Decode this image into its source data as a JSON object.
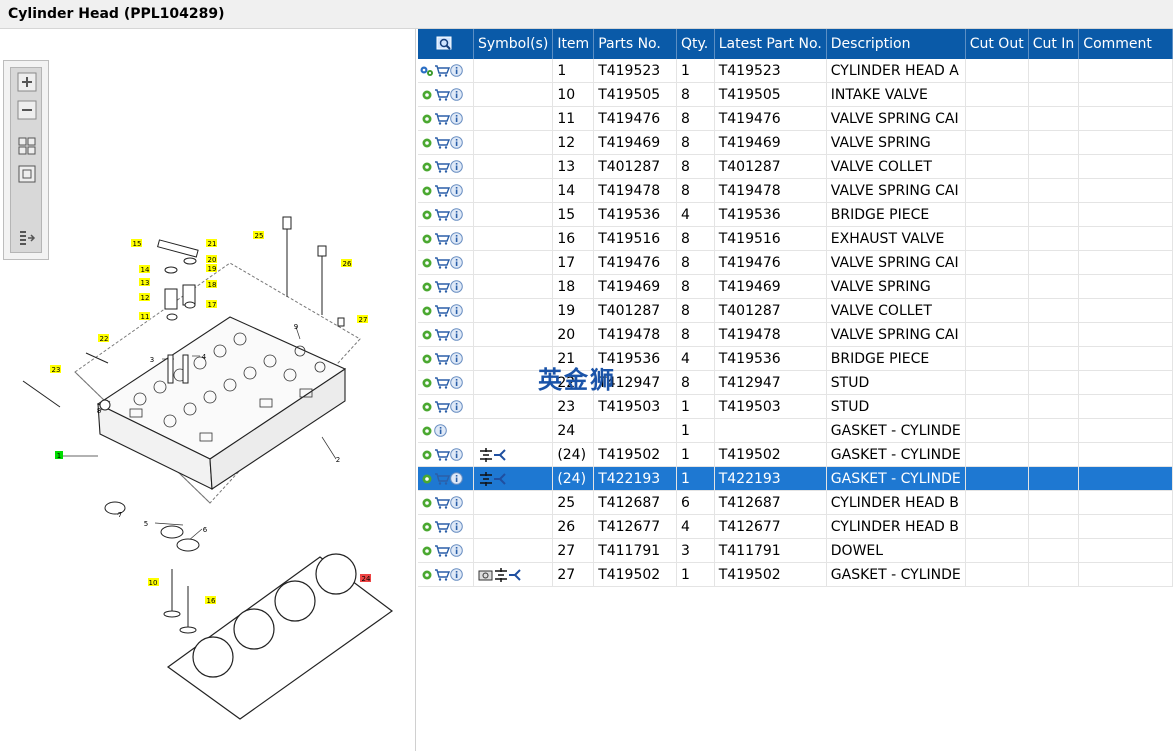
{
  "window": {
    "title": "Cylinder Head (PPL104289)"
  },
  "toolbox": {
    "buttons": [
      "zoom-in-icon",
      "zoom-out-icon",
      "fit-all-icon",
      "fit-window-icon",
      "export-icon"
    ]
  },
  "drawing": {
    "callouts": [
      "1",
      "2",
      "3",
      "4",
      "5",
      "6",
      "7",
      "8",
      "9",
      "10",
      "11",
      "12",
      "13",
      "14",
      "15",
      "16",
      "17",
      "18",
      "19",
      "20",
      "21",
      "22",
      "23",
      "24",
      "25",
      "26",
      "27"
    ]
  },
  "table": {
    "columns": [
      "Symbol(s)",
      "Item",
      "Parts No.",
      "Qty.",
      "Latest Part No.",
      "Description",
      "Cut Out",
      "Cut In",
      "Comment"
    ],
    "rows": [
      {
        "item": "1",
        "part": "T419523",
        "qty": "1",
        "latest": "T419523",
        "desc": "CYLINDER HEAD A",
        "sym": "",
        "cart": true,
        "first": "gears"
      },
      {
        "item": "10",
        "part": "T419505",
        "qty": "8",
        "latest": "T419505",
        "desc": "INTAKE VALVE",
        "sym": "",
        "cart": true,
        "first": "gear"
      },
      {
        "item": "11",
        "part": "T419476",
        "qty": "8",
        "latest": "T419476",
        "desc": "VALVE SPRING CAI",
        "sym": "",
        "cart": true,
        "first": "gear"
      },
      {
        "item": "12",
        "part": "T419469",
        "qty": "8",
        "latest": "T419469",
        "desc": "VALVE SPRING",
        "sym": "",
        "cart": true,
        "first": "gear"
      },
      {
        "item": "13",
        "part": "T401287",
        "qty": "8",
        "latest": "T401287",
        "desc": "VALVE COLLET",
        "sym": "",
        "cart": true,
        "first": "gear"
      },
      {
        "item": "14",
        "part": "T419478",
        "qty": "8",
        "latest": "T419478",
        "desc": "VALVE SPRING CAI",
        "sym": "",
        "cart": true,
        "first": "gear"
      },
      {
        "item": "15",
        "part": "T419536",
        "qty": "4",
        "latest": "T419536",
        "desc": "BRIDGE PIECE",
        "sym": "",
        "cart": true,
        "first": "gear"
      },
      {
        "item": "16",
        "part": "T419516",
        "qty": "8",
        "latest": "T419516",
        "desc": "EXHAUST VALVE",
        "sym": "",
        "cart": true,
        "first": "gear"
      },
      {
        "item": "17",
        "part": "T419476",
        "qty": "8",
        "latest": "T419476",
        "desc": "VALVE SPRING CAI",
        "sym": "",
        "cart": true,
        "first": "gear"
      },
      {
        "item": "18",
        "part": "T419469",
        "qty": "8",
        "latest": "T419469",
        "desc": "VALVE SPRING",
        "sym": "",
        "cart": true,
        "first": "gear"
      },
      {
        "item": "19",
        "part": "T401287",
        "qty": "8",
        "latest": "T401287",
        "desc": "VALVE COLLET",
        "sym": "",
        "cart": true,
        "first": "gear"
      },
      {
        "item": "20",
        "part": "T419478",
        "qty": "8",
        "latest": "T419478",
        "desc": "VALVE SPRING CAI",
        "sym": "",
        "cart": true,
        "first": "gear"
      },
      {
        "item": "21",
        "part": "T419536",
        "qty": "4",
        "latest": "T419536",
        "desc": "BRIDGE PIECE",
        "sym": "",
        "cart": true,
        "first": "gear"
      },
      {
        "item": "22",
        "part": "T412947",
        "qty": "8",
        "latest": "T412947",
        "desc": "STUD",
        "sym": "",
        "cart": true,
        "first": "gear"
      },
      {
        "item": "23",
        "part": "T419503",
        "qty": "1",
        "latest": "T419503",
        "desc": "STUD",
        "sym": "",
        "cart": true,
        "first": "gear"
      },
      {
        "item": "24",
        "part": "",
        "qty": "1",
        "latest": "",
        "desc": "GASKET - CYLINDE",
        "sym": "",
        "cart": false,
        "first": "gear"
      },
      {
        "item": "(24)",
        "part": "T419502",
        "qty": "1",
        "latest": "T419502",
        "desc": "GASKET - CYLINDE",
        "sym": "split",
        "cart": true,
        "first": "gear"
      },
      {
        "item": "(24)",
        "part": "T422193",
        "qty": "1",
        "latest": "T422193",
        "desc": "GASKET - CYLINDE",
        "sym": "split",
        "cart": true,
        "first": "gear",
        "selected": true
      },
      {
        "item": "25",
        "part": "T412687",
        "qty": "6",
        "latest": "T412687",
        "desc": "CYLINDER HEAD B",
        "sym": "",
        "cart": true,
        "first": "gear"
      },
      {
        "item": "26",
        "part": "T412677",
        "qty": "4",
        "latest": "T412677",
        "desc": "CYLINDER HEAD B",
        "sym": "",
        "cart": true,
        "first": "gear"
      },
      {
        "item": "27",
        "part": "T411791",
        "qty": "3",
        "latest": "T411791",
        "desc": "DOWEL",
        "sym": "",
        "cart": true,
        "first": "gear"
      },
      {
        "item": "27",
        "part": "T419502",
        "qty": "1",
        "latest": "T419502",
        "desc": "GASKET - CYLINDE",
        "sym": "camsplit",
        "cart": true,
        "first": "gear"
      }
    ]
  },
  "watermark": "英金狮",
  "colors": {
    "header_bg": "#0a5aa8",
    "selected_row": "#1e78d2",
    "callout_yellow": "#ffff00",
    "callout_green": "#00dd00",
    "callout_red": "#ee4444"
  }
}
